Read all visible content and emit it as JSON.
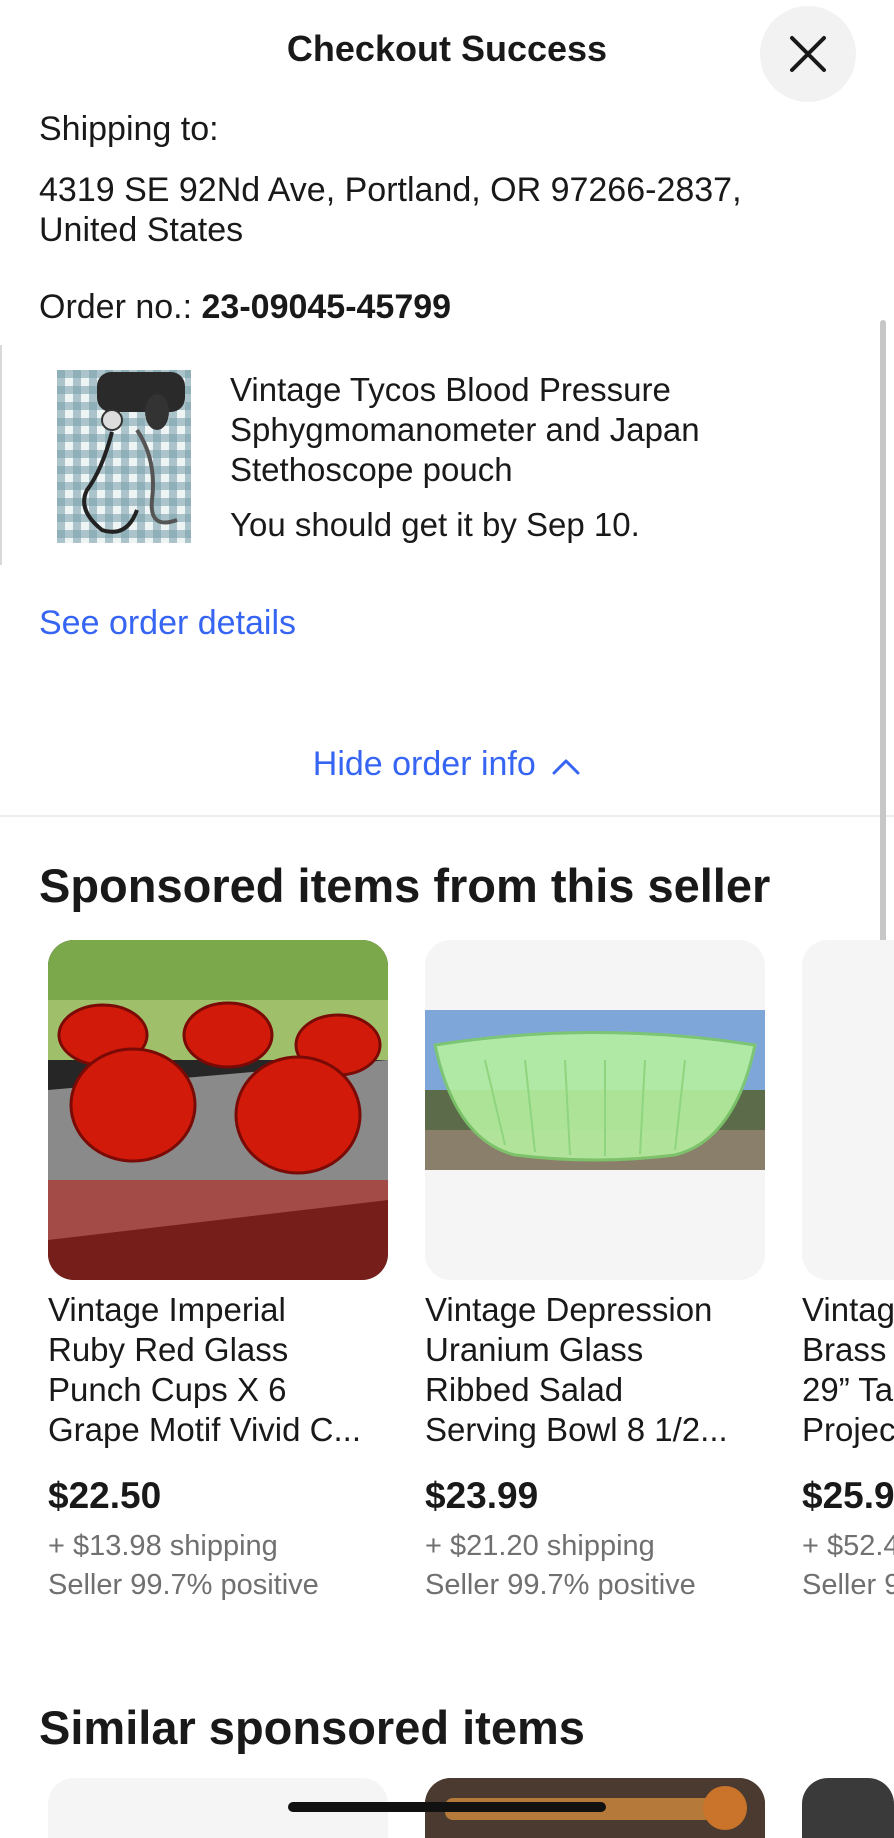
{
  "header": {
    "title": "Checkout Success"
  },
  "shipping": {
    "label": "Shipping to:",
    "address_line1": "4319 SE 92Nd Ave, Portland, OR 97266-2837,",
    "address_line2": "United States"
  },
  "order": {
    "label": "Order no.: ",
    "number": "23-09045-45799",
    "item": {
      "title_line1": "Vintage Tycos Blood Pressure",
      "title_line2": "Sphygmomanometer and Japan",
      "title_line3": "Stethoscope pouch",
      "eta": "You should get it by Sep 10."
    },
    "see_details": "See order details",
    "hide_info": "Hide order info"
  },
  "sponsored_seller": {
    "heading": "Sponsored items from this seller",
    "items": [
      {
        "title_lines": [
          "Vintage Imperial",
          "Ruby Red Glass",
          "Punch Cups X 6",
          "Grape Motif Vivid C..."
        ],
        "price": "$22.50",
        "shipping": "+ $13.98 shipping",
        "seller": "Seller 99.7% positive"
      },
      {
        "title_lines": [
          "Vintage Depression",
          "Uranium Glass",
          "Ribbed Salad",
          "Serving Bowl 8 1/2..."
        ],
        "price": "$23.99",
        "shipping": "+ $21.20 shipping",
        "seller": "Seller 99.7% positive"
      },
      {
        "title_lines": [
          "Vintag",
          "Brass",
          "29” Ta",
          "Projec"
        ],
        "price": "$25.9",
        "shipping": "+ $52.4",
        "seller": "Seller 9"
      }
    ]
  },
  "similar": {
    "heading": "Similar sponsored items"
  },
  "icons": {
    "close": "close-icon",
    "chevron": "chevron-up-icon"
  },
  "colors": {
    "link": "#3665f3",
    "muted": "#707070",
    "text": "#191919"
  }
}
